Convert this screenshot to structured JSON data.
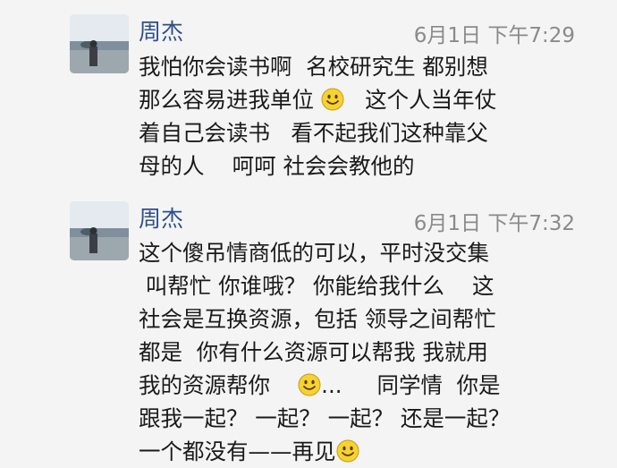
{
  "messages": [
    {
      "sender": "周杰",
      "time": "6月1日  下午7:29",
      "lines": [
        "我怕你会读书啊  名校研究生 都别想",
        "那么容易进我单位 {smile}   这个人当年仗",
        "着自己会读书   看不起我们这种靠父",
        "母的人    呵呵 社会会教他的"
      ]
    },
    {
      "sender": "周杰",
      "time": "6月1日  下午7:32",
      "lines": [
        "这个傻吊情商低的可以，平时没交集",
        " 叫帮忙 你谁哦？ 你能给我什么    这",
        "社会是互换资源，包括 领导之间帮忙",
        "都是  你有什么资源可以帮我 我就用",
        "我的资源帮你    {smile}...     同学情  你是",
        "跟我一起？ 一起？ 一起？ 还是一起？",
        "一个都没有——再见{smile}"
      ]
    }
  ],
  "icons": {
    "emoji": "smile-emoji-icon"
  },
  "colors": {
    "background": "#f4f4f4",
    "sender_name": "#2f4f88",
    "timestamp": "#8a8a8a",
    "text": "#1a1a1a"
  }
}
